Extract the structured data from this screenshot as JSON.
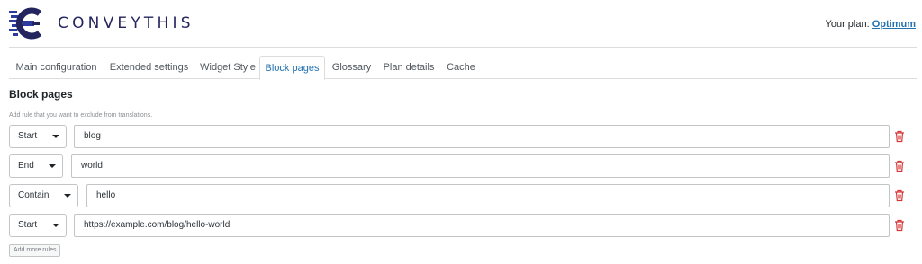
{
  "brand": {
    "name": "CONVEYTHIS",
    "logo_icon": "conveythis-logo-icon",
    "color": "#24255e"
  },
  "header": {
    "plan_label": "Your plan:",
    "plan_name": "Optimum"
  },
  "tabs": [
    {
      "label": "Main configuration",
      "active": false
    },
    {
      "label": "Extended settings",
      "active": false
    },
    {
      "label": "Widget Style",
      "active": false
    },
    {
      "label": "Block pages",
      "active": true
    },
    {
      "label": "Glossary",
      "active": false
    },
    {
      "label": "Plan details",
      "active": false
    },
    {
      "label": "Cache",
      "active": false
    }
  ],
  "section": {
    "title": "Block pages",
    "hint": "Add rule that you want to exclude from translations."
  },
  "rules": [
    {
      "match": "Start",
      "value": "blog",
      "delete_icon": "trash-icon"
    },
    {
      "match": "End",
      "value": "world",
      "delete_icon": "trash-icon"
    },
    {
      "match": "Contain",
      "value": "hello",
      "delete_icon": "trash-icon"
    },
    {
      "match": "Start",
      "value": "https://example.com/blog/hello-world",
      "delete_icon": "trash-icon"
    }
  ],
  "add_button_label": "Add more rules",
  "colors": {
    "accent": "#2271b1",
    "delete": "#d63638",
    "border": "#c3c4c7"
  }
}
